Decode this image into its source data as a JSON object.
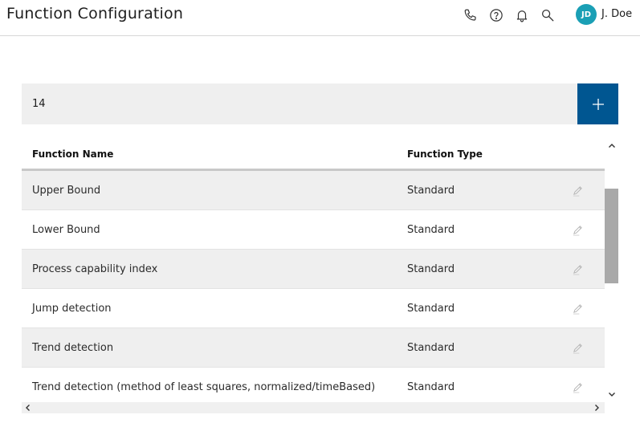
{
  "header": {
    "title": "Function Configuration",
    "icons": [
      "phone-icon",
      "help-icon",
      "bell-icon",
      "search-icon"
    ],
    "user": {
      "initials": "JD",
      "name": "J. Doe",
      "avatar_color": "#1a9fb5"
    }
  },
  "toolbar": {
    "count_value": "14",
    "add_button_color": "#005691"
  },
  "table": {
    "columns": [
      "Function Name",
      "Function Type"
    ],
    "rows": [
      {
        "name": "Upper Bound",
        "type": "Standard"
      },
      {
        "name": "Lower Bound",
        "type": "Standard"
      },
      {
        "name": "Process capability index",
        "type": "Standard"
      },
      {
        "name": "Jump detection",
        "type": "Standard"
      },
      {
        "name": "Trend detection",
        "type": "Standard"
      },
      {
        "name": "Trend detection (method of least squares, normalized/timeBased)",
        "type": "Standard"
      }
    ]
  }
}
